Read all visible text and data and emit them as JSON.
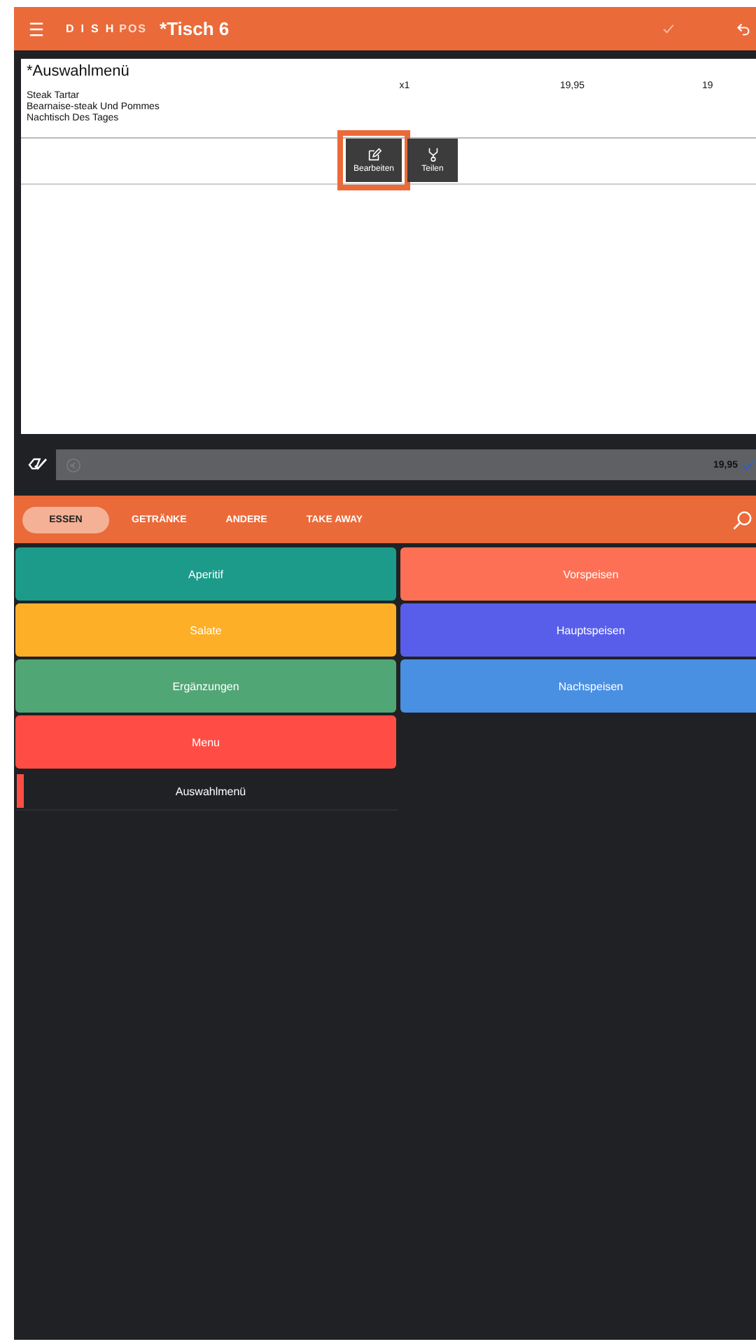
{
  "header": {
    "logo_main": "DISH",
    "logo_sub": "POS",
    "title": "*Tisch 6"
  },
  "order": {
    "items": [
      {
        "name": "*Auswahlmenü",
        "components": [
          "Steak Tartar",
          "Bearnaise-steak Und Pommes",
          "Nachtisch Des Tages"
        ],
        "quantity": "x1",
        "price": "19,95",
        "total": "19"
      }
    ],
    "actions": [
      {
        "label": "Bearbeiten",
        "kind": "edit",
        "highlighted": true
      },
      {
        "label": "Teilen",
        "kind": "split",
        "highlighted": false
      }
    ]
  },
  "payment_bar": {
    "total": "19,95"
  },
  "tabs": [
    {
      "label": "ESSEN",
      "selected": true
    },
    {
      "label": "GETRÄNKE",
      "selected": false
    },
    {
      "label": "ANDERE",
      "selected": false
    },
    {
      "label": "TAKE AWAY",
      "selected": false
    }
  ],
  "categories": [
    {
      "label": "Aperitif",
      "color": "#1c9a8a"
    },
    {
      "label": "Vorspeisen",
      "color": "#fd7055"
    },
    {
      "label": "Salate",
      "color": "#fdaf28"
    },
    {
      "label": "Hauptspeisen",
      "color": "#585eea"
    },
    {
      "label": "Ergänzungen",
      "color": "#51a676"
    },
    {
      "label": "Nachspeisen",
      "color": "#4a90e2"
    },
    {
      "label": "Menu",
      "color": "#ff4d45"
    }
  ],
  "products": [
    {
      "name": "Auswahlmenü",
      "color": "#ff4d45"
    }
  ]
}
